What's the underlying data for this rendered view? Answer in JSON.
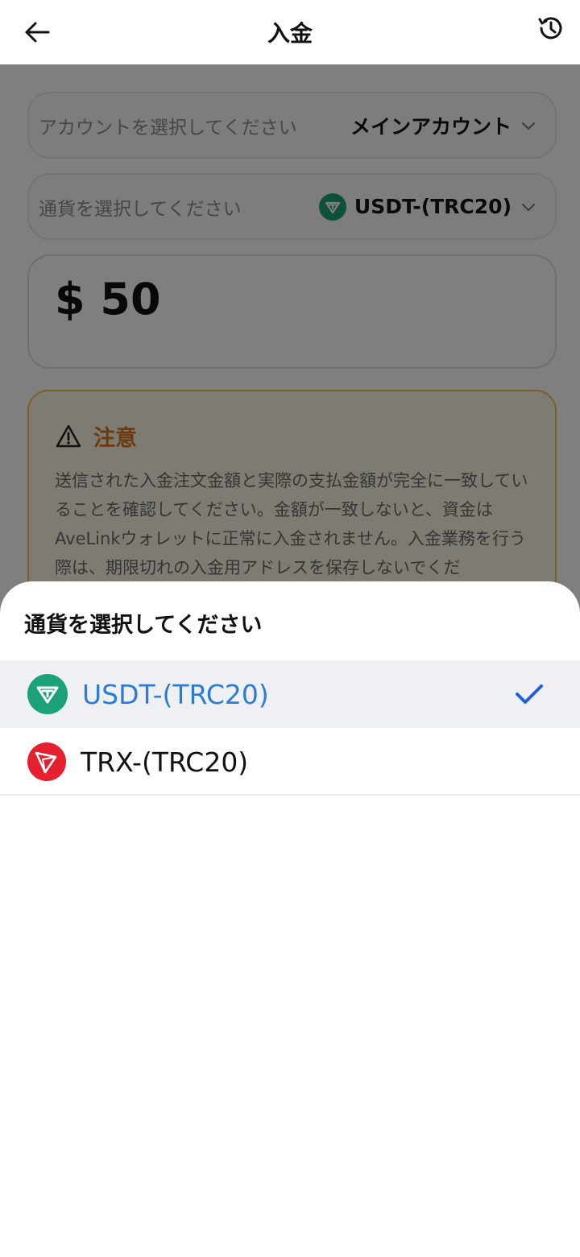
{
  "header": {
    "title": "入金"
  },
  "account_field": {
    "placeholder": "アカウントを選択してください",
    "value": "メインアカウント"
  },
  "currency_field": {
    "placeholder": "通貨を選択してください",
    "value": "USDT-(TRC20)"
  },
  "amount": {
    "display": "$ 50"
  },
  "notice": {
    "title": "注意",
    "body": "送信された入金注文金額と実際の支払金額が完全に一致していることを確認してください。金額が一致しないと、資金はAveLinkウォレットに正常に入金されません。入金業務を行う際は、期限切れの入金用アドレスを保存しないでくだ"
  },
  "sheet": {
    "title": "通貨を選択してください",
    "options": [
      {
        "label": "USDT-(TRC20)",
        "icon": "tether-icon",
        "selected": true
      },
      {
        "label": "TRX-(TRC20)",
        "icon": "tron-icon",
        "selected": false
      }
    ]
  },
  "colors": {
    "accent_blue": "#2c7cd4",
    "check_blue": "#1f5fe0",
    "warning_orange": "#d7761e",
    "tether_green": "#1ba27a",
    "tron_red": "#e5202f"
  }
}
